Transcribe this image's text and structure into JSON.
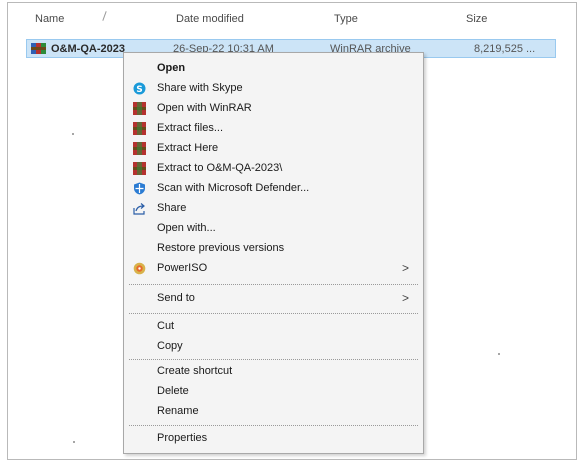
{
  "columns": {
    "name": "Name",
    "date_modified": "Date modified",
    "type": "Type",
    "size": "Size"
  },
  "file": {
    "name": "O&M-QA-2023",
    "date_modified": "26-Sep-22 10:31 AM",
    "type": "WinRAR archive",
    "size": "8,219,525 ..."
  },
  "context_menu": {
    "items": [
      {
        "label": "Open",
        "icon": "none"
      },
      {
        "label": "Share with Skype",
        "icon": "skype-icon"
      },
      {
        "label": "Open with WinRAR",
        "icon": "winrar-icon"
      },
      {
        "label": "Extract files...",
        "icon": "winrar-icon"
      },
      {
        "label": "Extract Here",
        "icon": "winrar-icon"
      },
      {
        "label": "Extract to O&M-QA-2023\\",
        "icon": "winrar-icon"
      },
      {
        "label": "Scan with Microsoft Defender...",
        "icon": "defender-shield-icon"
      },
      {
        "label": "Share",
        "icon": "share-icon"
      },
      {
        "label": "Open with...",
        "icon": "none"
      },
      {
        "label": "Restore previous versions",
        "icon": "none"
      },
      {
        "label": "PowerISO",
        "icon": "poweriso-icon",
        "submenu_arrow": ">"
      },
      {
        "label": "Send to",
        "icon": "none",
        "submenu_arrow": ">"
      },
      {
        "label": "Cut",
        "icon": "none"
      },
      {
        "label": "Copy",
        "icon": "none"
      },
      {
        "label": "Create shortcut",
        "icon": "none"
      },
      {
        "label": "Delete",
        "icon": "none"
      },
      {
        "label": "Rename",
        "icon": "none"
      },
      {
        "label": "Properties",
        "icon": "none"
      }
    ]
  },
  "colors": {
    "selection_bg": "#cce4f7",
    "menu_bg": "#f4f4f4",
    "winrar_red": "#b5322f",
    "skype_blue": "#1a9ad9"
  }
}
